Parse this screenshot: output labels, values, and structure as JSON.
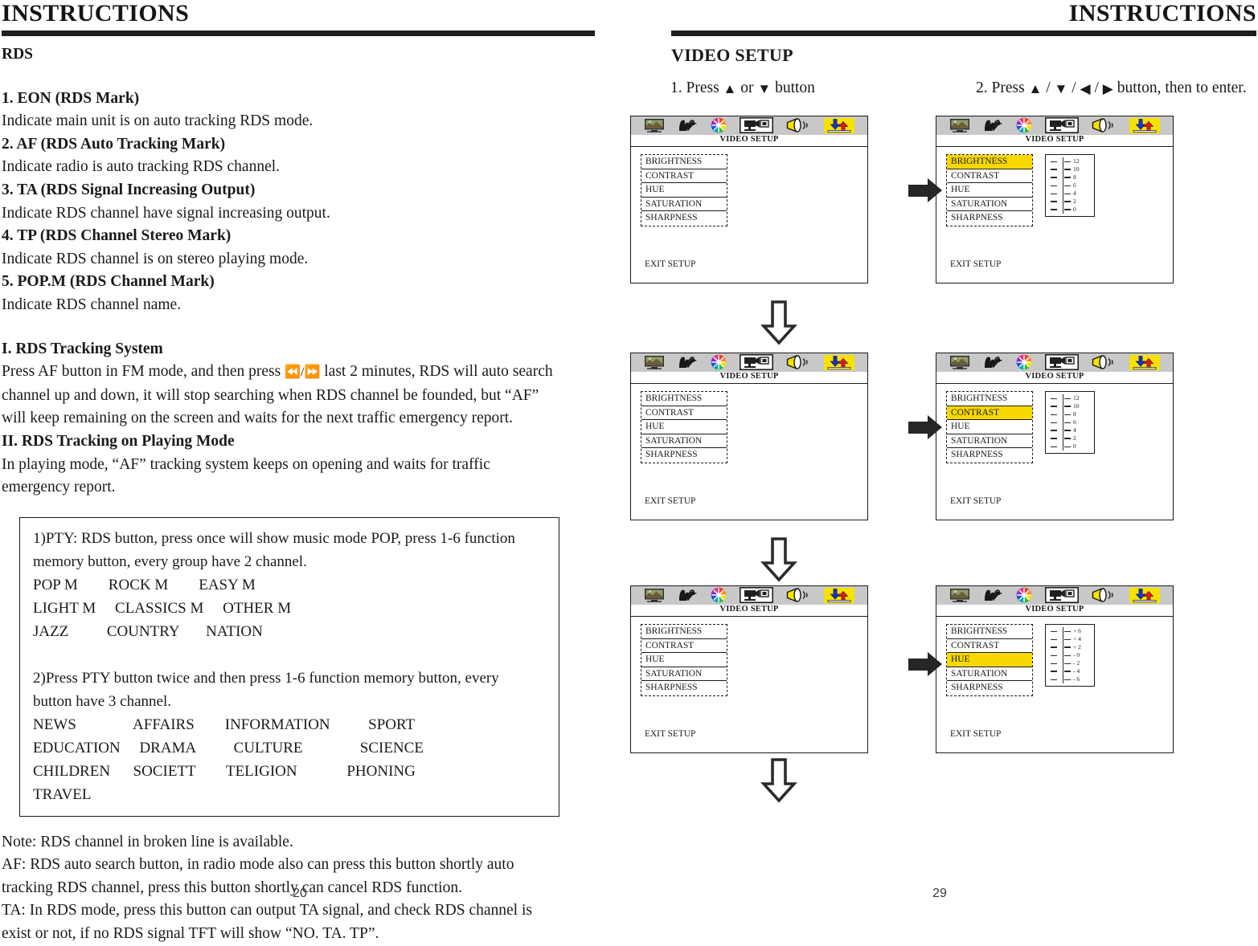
{
  "left_page": {
    "header_title": "INSTRUCTIONS",
    "page_number": "20",
    "section_heading": "RDS",
    "items": [
      {
        "heading": "1. EON (RDS Mark)",
        "text": "Indicate main unit is on auto tracking RDS mode."
      },
      {
        "heading": "2. AF (RDS Auto Tracking Mark)",
        "text": "Indicate radio is auto tracking RDS channel."
      },
      {
        "heading": "3. TA (RDS Signal Increasing Output)",
        "text": "Indicate RDS channel have signal increasing output."
      },
      {
        "heading": "4. TP (RDS Channel Stereo Mark)",
        "text": "Indicate RDS channel is on stereo playing mode."
      },
      {
        "heading": "5. POP.M (RDS Channel Mark)",
        "text": "Indicate RDS channel name."
      }
    ],
    "tracking_system": {
      "heading": "I. RDS Tracking System",
      "line1_a": "Press AF button in FM mode, and then press ",
      "line1_icons": "⏪/⏩",
      "line1_b": " last 2 minutes, RDS will auto search",
      "line2": "channel up and down, it will stop searching when RDS channel be founded, but “AF”",
      "line3": "will keep remaining on the screen and waits for the next traffic emergency report."
    },
    "tracking_playing": {
      "heading": "II. RDS Tracking on Playing Mode",
      "line1": "In playing mode, “AF” tracking system keeps on opening and waits for traffic",
      "line2": "emergency report."
    },
    "pty_box": {
      "p1_line1": "1)PTY: RDS button, press once will show music mode POP, press 1-6 function",
      "p1_line2": "memory button, every group have 2 channel.",
      "p1_row1": "POP M        ROCK M        EASY M",
      "p1_row2": "LIGHT M     CLASSICS M     OTHER M",
      "p1_row3": "JAZZ          COUNTRY       NATION",
      "p2_line1": "2)Press PTY button twice and then press 1-6 function memory button, every",
      "p2_line2": "button have 3 channel.",
      "p2_row1": "NEWS               AFFAIRS        INFORMATION          SPORT",
      "p2_row2": "EDUCATION     DRAMA          CULTURE               SCIENCE",
      "p2_row3": "CHILDREN      SOCIETT        TELIGION             PHONING",
      "p2_row4": "TRAVEL"
    },
    "note": {
      "label": "Note:",
      "line1": " RDS channel in broken line is available.",
      "line2": "AF: RDS auto search button, in radio mode also can press this button shortly auto",
      "line3": "tracking RDS channel, press this button shortly can cancel RDS function.",
      "line4": "TA: In RDS mode, press this button can output TA signal, and check RDS channel is",
      "line5": "exist or not, if no RDS signal TFT will show “NO. TA. TP”."
    }
  },
  "right_page": {
    "header_title": "INSTRUCTIONS",
    "page_number": "29",
    "section_title": "VIDEO SETUP",
    "step1": {
      "prefix": "1. Press ",
      "up": "▲",
      "mid": " or ",
      "down": "▼",
      "suffix": " button"
    },
    "step2": {
      "prefix": "2. Press ",
      "up": "▲",
      "s1": " / ",
      "down": "▼",
      "s2": " / ",
      "left": "◀",
      "s3": " / ",
      "right": "▶",
      "suffix": " button, then to enter."
    },
    "osd_common": {
      "title": "VIDEO SETUP",
      "exit_label": "EXIT SETUP",
      "icons": [
        "picture-icon",
        "preference-icon",
        "color-wheel-icon",
        "video-camera-icon",
        "speaker-icon",
        "updown-arrows-icon"
      ],
      "menu_items": [
        "BRIGHTNESS",
        "CONTRAST",
        "HUE",
        "SATURATION",
        "SHARPNESS"
      ],
      "highlight_color": "#f7d800",
      "bar_color": "#c8c8c8"
    },
    "screens": [
      {
        "id": "screen-1-1",
        "selected": null,
        "scale": null
      },
      {
        "id": "screen-1-2",
        "selected": "BRIGHTNESS",
        "scale": {
          "values": [
            "12",
            "10",
            "8",
            "6",
            "4",
            "2",
            "0"
          ],
          "marker_index": 3,
          "thick": [
            1,
            2,
            5,
            6
          ]
        }
      },
      {
        "id": "screen-2-1",
        "selected": null,
        "scale": null
      },
      {
        "id": "screen-2-2",
        "selected": "CONTRAST",
        "scale": {
          "values": [
            "12",
            "10",
            "8",
            "6",
            "4",
            "2",
            "0"
          ],
          "marker_index": 3,
          "thick": [
            1,
            4,
            5
          ]
        }
      },
      {
        "id": "screen-3-1",
        "selected": null,
        "scale": null
      },
      {
        "id": "screen-3-2",
        "selected": "HUE",
        "scale": {
          "values": [
            "+ 6",
            "+ 4",
            "+ 2",
            "- 0",
            "- 2",
            "- 4",
            "- 6"
          ],
          "marker_index": 3,
          "thick": [
            2,
            5
          ]
        }
      }
    ],
    "flow_arrows": {
      "right_arrow": "arrow-right-icon",
      "down_arrow": "arrow-down-icon"
    }
  }
}
